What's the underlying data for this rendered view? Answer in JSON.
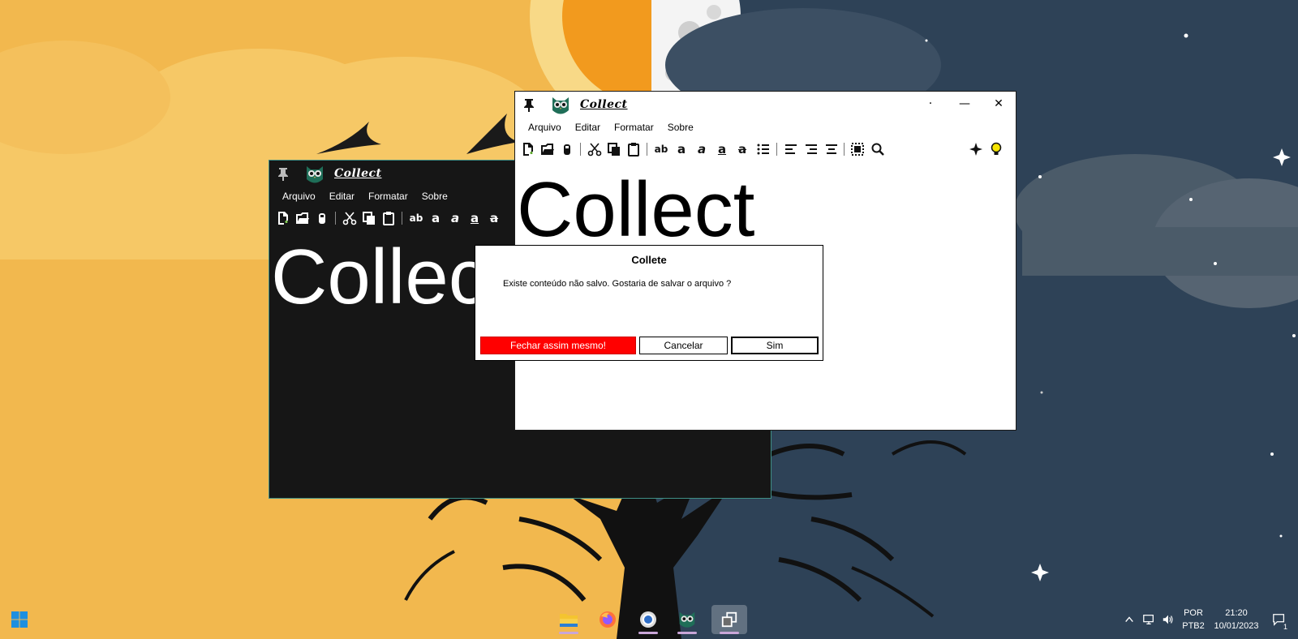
{
  "desktop": {
    "wallpaper": "day-night-tree-wallpaper"
  },
  "window_back": {
    "title": "Collect",
    "menu": [
      "Arquivo",
      "Editar",
      "Formatar",
      "Sobre"
    ],
    "content": "Collect",
    "theme": "dark"
  },
  "window_front": {
    "title": "Collect",
    "menu": [
      "Arquivo",
      "Editar",
      "Formatar",
      "Sobre"
    ],
    "content": "Collect",
    "theme": "light",
    "controls": {
      "more": "·",
      "minimize": "—",
      "close": "✕"
    },
    "toolbar_text": {
      "bold_plain": "ab",
      "a": "a"
    }
  },
  "dialog": {
    "title": "Collete",
    "message": "Existe conteúdo não salvo. Gostaria de salvar o arquivo ?",
    "buttons": {
      "close_anyway": "Fechar assim mesmo!",
      "cancel": "Cancelar",
      "yes": "Sim"
    },
    "danger_color": "#ff0000"
  },
  "taskbar": {
    "apps": [
      "file-explorer-icon",
      "firefox-icon",
      "chromium-icon",
      "collect-owl-icon",
      "task-view-icon"
    ],
    "language": {
      "line1": "POR",
      "line2": "PTB2"
    },
    "clock": {
      "time": "21:20",
      "date": "10/01/2023"
    },
    "notification_count": "1"
  }
}
